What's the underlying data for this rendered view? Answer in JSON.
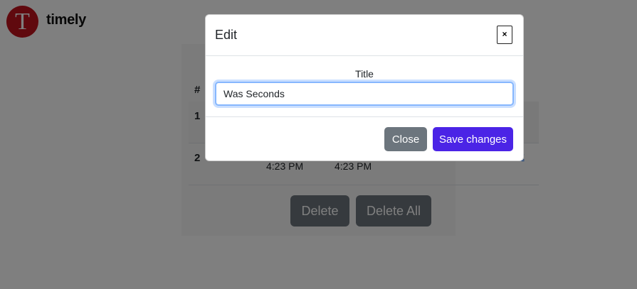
{
  "app": {
    "logo_letter": "T",
    "name": "timely"
  },
  "table": {
    "header_index": "#",
    "rows": [
      {
        "index": "1",
        "time_a": "",
        "time_b": "",
        "action": ""
      },
      {
        "index": "2",
        "time_a": "4:23 PM",
        "time_b": "4:23 PM",
        "action": "edit"
      }
    ]
  },
  "actions": {
    "delete": "Delete",
    "delete_all": "Delete All"
  },
  "modal": {
    "title": "Edit",
    "close_icon": "×",
    "field_label": "Title",
    "field_value": "Was Seconds",
    "close_button": "Close",
    "save_button": "Save changes"
  },
  "colors": {
    "logo": "#c0121d",
    "primary": "#4b24e6",
    "secondary": "#6c757d",
    "focus": "#86b7fe"
  }
}
